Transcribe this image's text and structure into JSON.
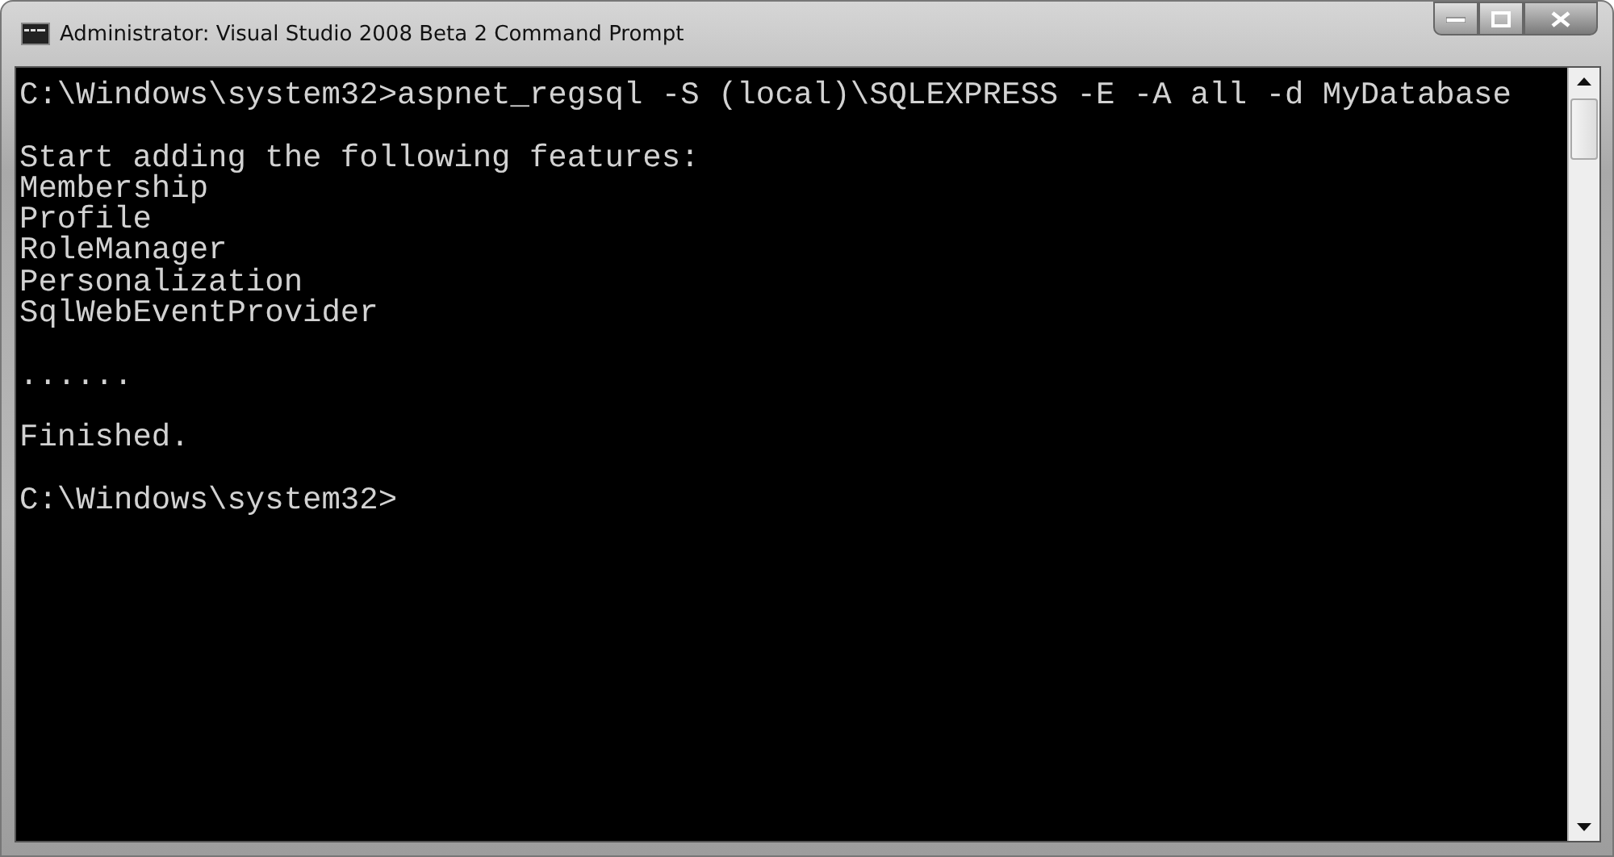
{
  "window": {
    "title": "Administrator: Visual Studio 2008 Beta 2 Command Prompt"
  },
  "console": {
    "blocks": [
      [
        "C:\\Windows\\system32>aspnet_regsql -S (local)\\SQLEXPRESS -E -A all -d MyDatabase"
      ],
      [
        "Start adding the following features:",
        "Membership",
        "Profile",
        "RoleManager",
        "Personalization",
        "SqlWebEventProvider"
      ],
      [
        "......"
      ],
      [
        "Finished."
      ],
      [
        "C:\\Windows\\system32>"
      ]
    ]
  }
}
